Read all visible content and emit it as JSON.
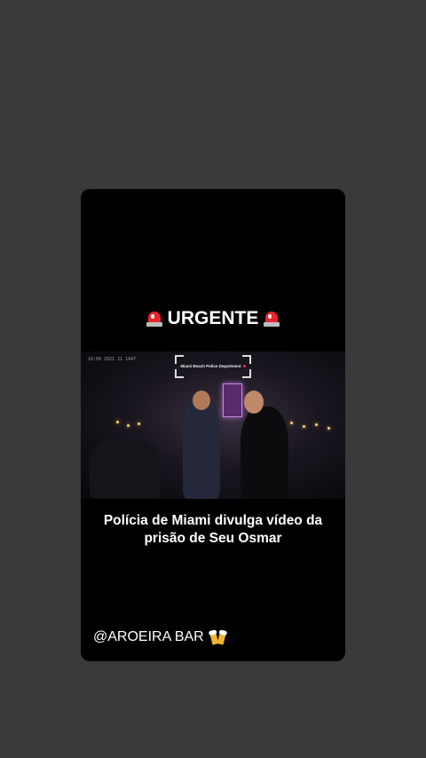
{
  "story": {
    "headline": "URGENTE",
    "headline_icon": "police-siren-icon",
    "video": {
      "camera_timestamp": "10:00 2021 21 1447",
      "watermark": "Miami Beach Police Department"
    },
    "title": "Polícia de Miami divulga vídeo da prisão de Seu Osmar",
    "handle": "@AROEIRA BAR",
    "handle_icon": "beer-mugs-icon"
  },
  "colors": {
    "background": "#3a3a3a",
    "card": "#000000",
    "text": "#ffffff",
    "siren": "#e8242b"
  }
}
